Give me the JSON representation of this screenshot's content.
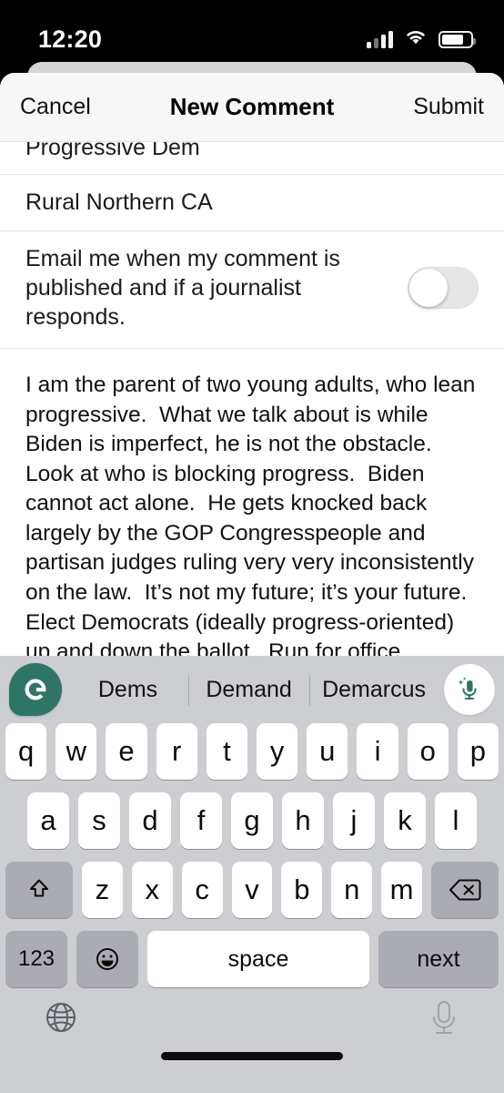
{
  "status_bar": {
    "time": "12:20",
    "signal_icon": "cellular-signal-icon",
    "wifi_icon": "wifi-icon",
    "battery_icon": "battery-icon"
  },
  "navbar": {
    "cancel_label": "Cancel",
    "title": "New Comment",
    "submit_label": "Submit"
  },
  "form": {
    "affiliation_value": "Progressive Dem",
    "location_value": "Rural Northern CA",
    "notify_label": "Email me when my comment is published and if a journalist responds.",
    "notify_state": "off"
  },
  "comment": {
    "body": "I am the parent of two young adults, who lean progressive.  What we talk about is while Biden is imperfect, he is not the obstacle.  Look at who is blocking progress.  Biden cannot act alone.  He gets knocked back largely by the GOP Congresspeople and partisan judges ruling very very inconsistently on the law.  It’s not my future; it’s your future.  Elect Democrats (ideally progress-oriented) up and down the ballot.  Run for office, volunteer, be civic-minded.  I get Biden may not be your choice (I get it, I supported Warren) but don’t throw out the baby with the bathwater.\n\nI’m in your corner."
  },
  "keyboard": {
    "brand_logo": "grammarly-logo",
    "brand_letter": "G",
    "brand_color": "#2f7565",
    "suggestions": [
      "Dems",
      "Demand",
      "Demarcus"
    ],
    "mic_button_icon": "grammarly-voice-mic-icon",
    "row1": [
      "q",
      "w",
      "e",
      "r",
      "t",
      "y",
      "u",
      "i",
      "o",
      "p"
    ],
    "row2": [
      "a",
      "s",
      "d",
      "f",
      "g",
      "h",
      "j",
      "k",
      "l"
    ],
    "row3": [
      "z",
      "x",
      "c",
      "v",
      "b",
      "n",
      "m"
    ],
    "shift_icon": "shift-icon",
    "backspace_icon": "backspace-icon",
    "numbers_label": "123",
    "emoji_icon": "emoji-smiley-icon",
    "space_label": "space",
    "return_label": "next",
    "globe_icon": "globe-icon",
    "dictation_icon": "dictation-mic-icon"
  }
}
